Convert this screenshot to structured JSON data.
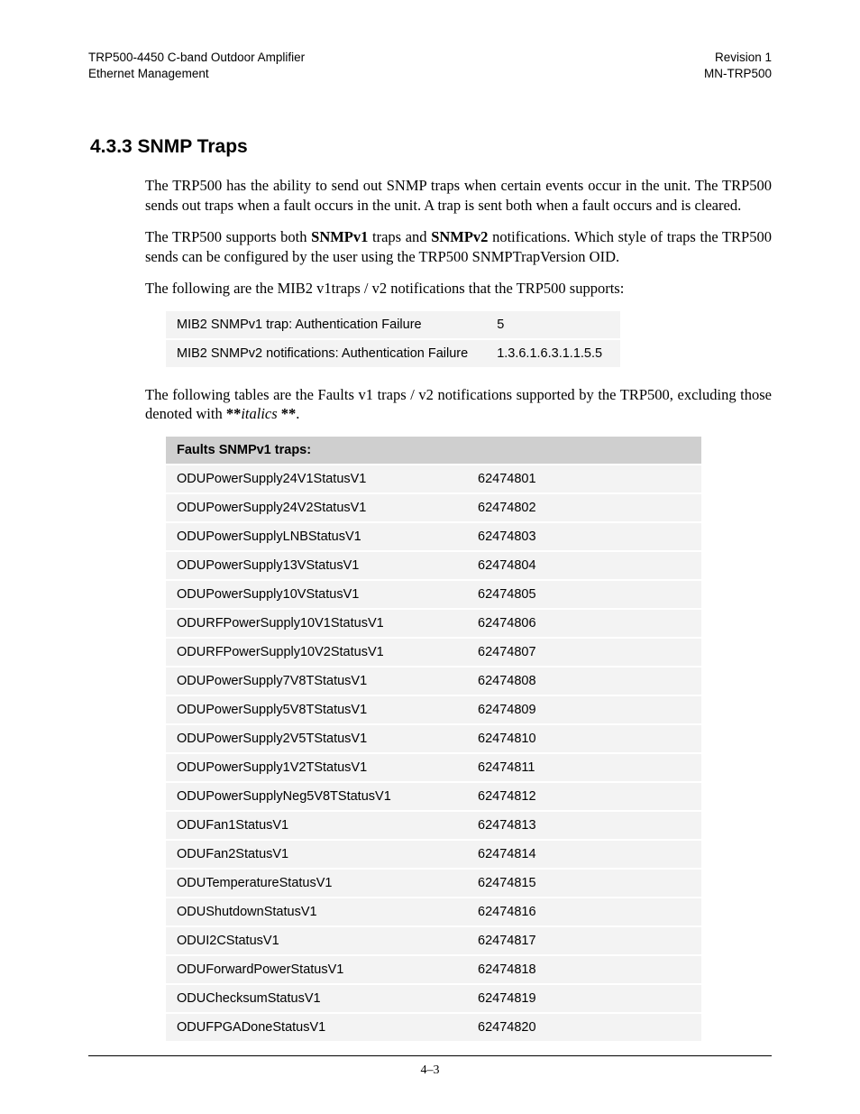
{
  "header": {
    "left_line1": "TRP500-4450 C-band Outdoor Amplifier",
    "left_line2": "Ethernet Management",
    "right_line1": "Revision 1",
    "right_line2": "MN-TRP500"
  },
  "section": {
    "number_title": "4.3.3  SNMP Traps",
    "para1": "The TRP500 has the ability to send out SNMP traps when certain events occur in the unit. The TRP500 sends out traps when a fault occurs in the unit. A trap is sent both when a fault occurs and is cleared.",
    "para2_a": "The TRP500 supports both ",
    "para2_b1": "SNMPv1",
    "para2_b2": " traps and ",
    "para2_b3": "SNMPv2",
    "para2_c": " notifications. Which style of traps the TRP500 sends can be configured by the user using the TRP500 SNMPTrapVersion OID.",
    "para3": "The following are the MIB2 v1traps / v2 notifications that the TRP500 supports:",
    "para4_a": "The following tables are the Faults v1 traps / v2 notifications supported by the TRP500, excluding those denoted with ",
    "para4_b": "**",
    "para4_c": "italics",
    "para4_d": " **",
    "para4_e": "."
  },
  "mib2_table": {
    "rows": [
      {
        "label": "MIB2 SNMPv1 trap: Authentication Failure",
        "value": "5"
      },
      {
        "label": "MIB2 SNMPv2 notifications: Authentication Failure",
        "value": "1.3.6.1.6.3.1.1.5.5"
      }
    ]
  },
  "faults_table": {
    "header": "Faults SNMPv1 traps:",
    "rows": [
      {
        "name": "ODUPowerSupply24V1StatusV1",
        "id": "62474801"
      },
      {
        "name": "ODUPowerSupply24V2StatusV1",
        "id": "62474802"
      },
      {
        "name": "ODUPowerSupplyLNBStatusV1",
        "id": "62474803"
      },
      {
        "name": "ODUPowerSupply13VStatusV1",
        "id": "62474804"
      },
      {
        "name": "ODUPowerSupply10VStatusV1",
        "id": "62474805"
      },
      {
        "name": "ODURFPowerSupply10V1StatusV1",
        "id": "62474806"
      },
      {
        "name": "ODURFPowerSupply10V2StatusV1",
        "id": "62474807"
      },
      {
        "name": "ODUPowerSupply7V8TStatusV1",
        "id": "62474808"
      },
      {
        "name": "ODUPowerSupply5V8TStatusV1",
        "id": "62474809"
      },
      {
        "name": "ODUPowerSupply2V5TStatusV1",
        "id": "62474810"
      },
      {
        "name": "ODUPowerSupply1V2TStatusV1",
        "id": "62474811"
      },
      {
        "name": "ODUPowerSupplyNeg5V8TStatusV1",
        "id": "62474812"
      },
      {
        "name": "ODUFan1StatusV1",
        "id": "62474813"
      },
      {
        "name": "ODUFan2StatusV1",
        "id": "62474814"
      },
      {
        "name": "ODUTemperatureStatusV1",
        "id": "62474815"
      },
      {
        "name": "ODUShutdownStatusV1",
        "id": "62474816"
      },
      {
        "name": "ODUI2CStatusV1",
        "id": "62474817"
      },
      {
        "name": "ODUForwardPowerStatusV1",
        "id": "62474818"
      },
      {
        "name": "ODUChecksumStatusV1",
        "id": "62474819"
      },
      {
        "name": "ODUFPGADoneStatusV1",
        "id": "62474820"
      }
    ]
  },
  "footer": {
    "page_number": "4–3"
  }
}
